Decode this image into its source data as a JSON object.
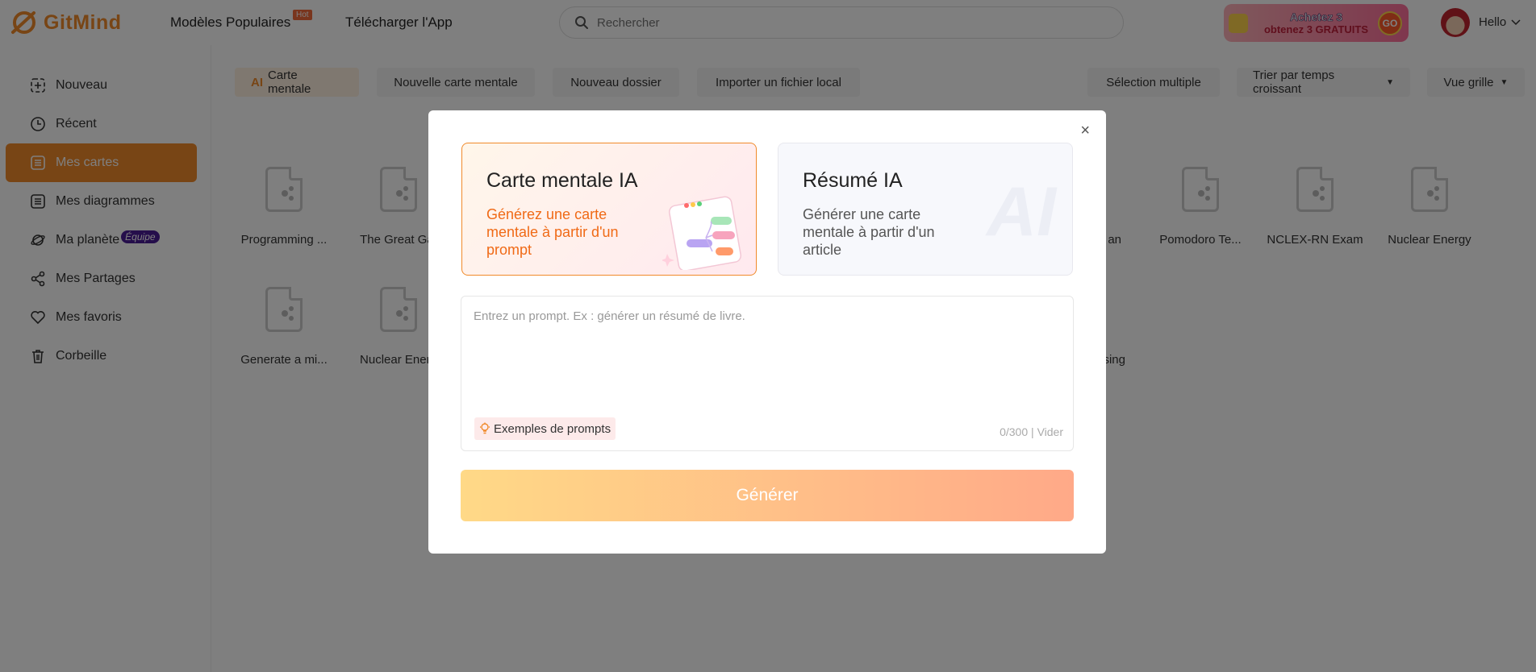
{
  "header": {
    "brand": "GitMind",
    "nav": [
      {
        "label": "Modèles Populaires"
      },
      {
        "label": "Télécharger l'App"
      }
    ],
    "hot_badge": "Hot",
    "search_placeholder": "Rechercher",
    "promo": {
      "line1": "Achetez 3",
      "line2": "obtenez 3 GRATUITS",
      "go": "GO"
    },
    "user_greeting": "Hello"
  },
  "sidebar": {
    "items": [
      {
        "label": "Nouveau",
        "icon": "new-icon"
      },
      {
        "label": "Récent",
        "icon": "clock-icon"
      },
      {
        "label": "Mes cartes",
        "icon": "list-icon",
        "active": true
      },
      {
        "label": "Mes diagrammes",
        "icon": "list-icon"
      },
      {
        "label": "Ma planète",
        "icon": "planet-icon",
        "badge": "Équipe"
      },
      {
        "label": "Mes Partages",
        "icon": "share-icon"
      },
      {
        "label": "Mes favoris",
        "icon": "heart-icon"
      },
      {
        "label": "Corbeille",
        "icon": "trash-icon"
      }
    ]
  },
  "toolbar": {
    "ai_tag": "AI",
    "ai_label": "Carte mentale",
    "new_map": "Nouvelle carte mentale",
    "new_folder": "Nouveau dossier",
    "import": "Importer un fichier local",
    "multi_select": "Sélection multiple",
    "sort": "Trier par temps croissant",
    "view": "Vue grille"
  },
  "files": [
    {
      "name": "Programming ..."
    },
    {
      "name": "The Great Gat"
    },
    {
      "name": "an"
    },
    {
      "name": "Pomodoro Te..."
    },
    {
      "name": "NCLEX-RN Exam"
    },
    {
      "name": "Nuclear Energy"
    },
    {
      "name": "Generate a mi..."
    },
    {
      "name": "Nuclear Energ"
    },
    {
      "name": "sing"
    }
  ],
  "modal": {
    "close": "×",
    "card_left": {
      "title": "Carte mentale IA",
      "desc": "Générez une carte mentale à partir d'un prompt"
    },
    "card_right": {
      "title": "Résumé IA",
      "desc": "Générer une carte mentale à partir d'un article",
      "watermark": "AI"
    },
    "prompt_placeholder": "Entrez un prompt. Ex : générer un résumé de livre.",
    "examples_label": "Exemples de prompts",
    "counter": "0/300",
    "clear": "Vider",
    "generate": "Générer"
  },
  "colors": {
    "accent": "#f08a2a",
    "overlay": "rgba(0,0,0,0.5)"
  }
}
